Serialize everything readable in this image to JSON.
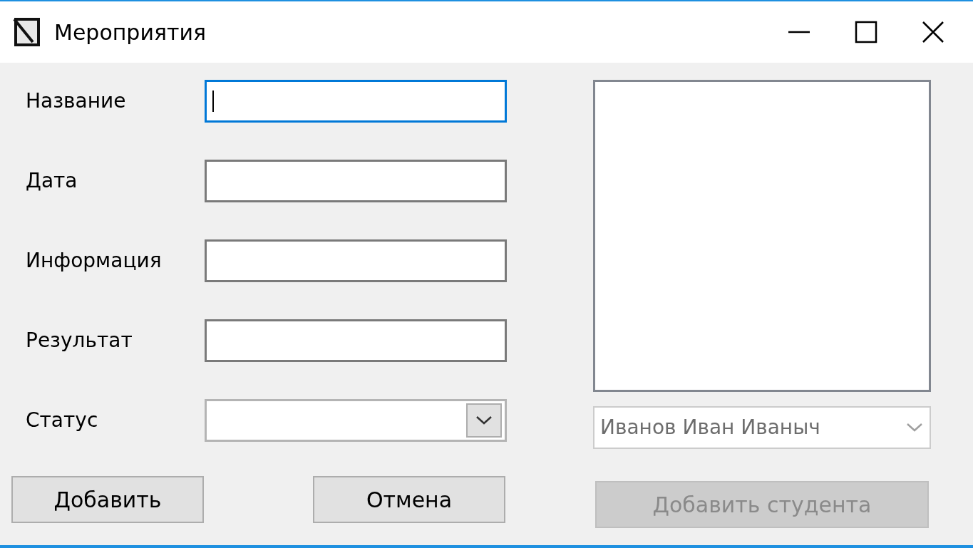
{
  "window": {
    "title": "Мероприятия"
  },
  "fields": [
    {
      "label": "Название",
      "kind": "text",
      "focused": true
    },
    {
      "label": "Дата",
      "kind": "text",
      "focused": false
    },
    {
      "label": "Информация",
      "kind": "text",
      "focused": false
    },
    {
      "label": "Результат",
      "kind": "text",
      "focused": false
    },
    {
      "label": "Статус",
      "kind": "combo",
      "focused": false
    }
  ],
  "student_combo": {
    "value": "Иванов Иван Иваныч",
    "disabled": true
  },
  "buttons": [
    {
      "label": "Добавить",
      "disabled": false
    },
    {
      "label": "Отмена",
      "disabled": false
    }
  ],
  "add_student_button": {
    "label": "Добавить студента",
    "disabled": true
  }
}
